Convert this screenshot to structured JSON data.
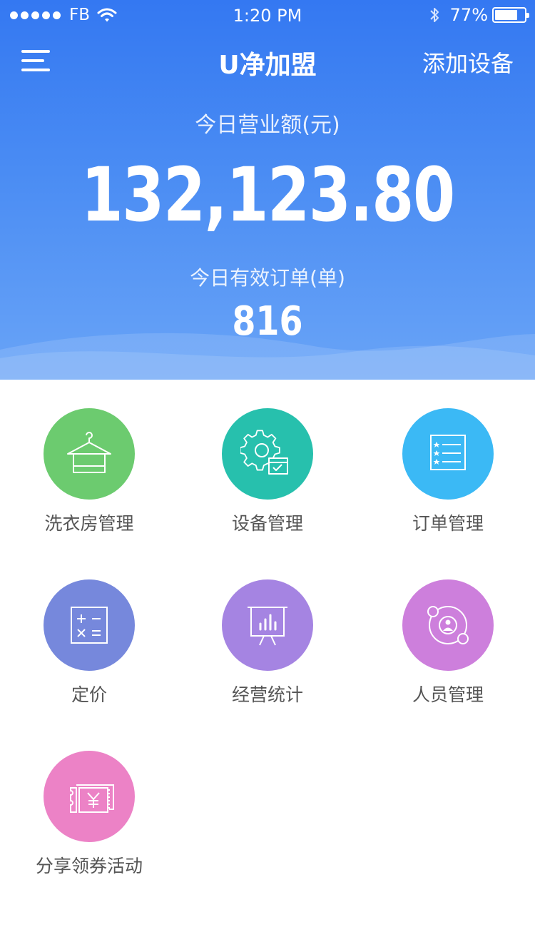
{
  "status_bar": {
    "carrier": "FB",
    "time": "1:20 PM",
    "battery": "77%",
    "battery_level": 0.77
  },
  "nav": {
    "title": "U净加盟",
    "add_device": "添加设备",
    "menu_icon": "hamburger-menu-icon"
  },
  "summary": {
    "revenue_label": "今日营业额(元)",
    "revenue_value": "132,123.80",
    "orders_label": "今日有效订单(单)",
    "orders_value": "816"
  },
  "colors": {
    "header_top": "#3478f2",
    "header_bottom": "#69a4f7"
  },
  "menu": [
    {
      "label": "洗衣房管理",
      "icon": "hanger-towel-icon",
      "color": "#6ccb6f"
    },
    {
      "label": "设备管理",
      "icon": "gear-device-icon",
      "color": "#27c0ad"
    },
    {
      "label": "订单管理",
      "icon": "order-list-icon",
      "color": "#3bb9f5"
    },
    {
      "label": "定价",
      "icon": "calculator-icon",
      "color": "#7688dc"
    },
    {
      "label": "经营统计",
      "icon": "bar-chart-board-icon",
      "color": "#a584e2"
    },
    {
      "label": "人员管理",
      "icon": "people-orbit-icon",
      "color": "#cd7fdc"
    },
    {
      "label": "分享领券活动",
      "icon": "coupon-yen-icon",
      "color": "#ec82c6"
    }
  ]
}
